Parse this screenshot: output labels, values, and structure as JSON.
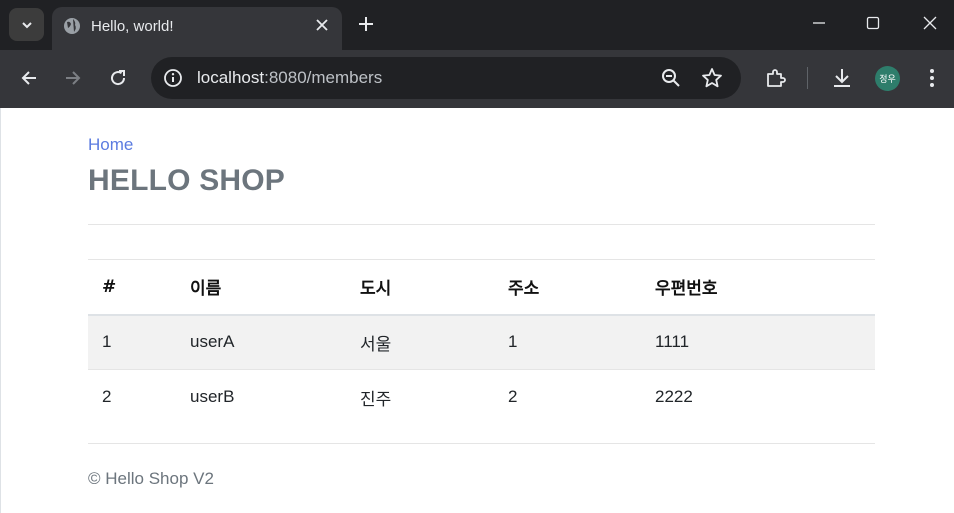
{
  "browser": {
    "tab_title": "Hello, world!",
    "url_host": "localhost",
    "url_path": ":8080/members",
    "profile_initials": "정우"
  },
  "page": {
    "home_link": "Home",
    "brand": "HELLO SHOP",
    "table": {
      "headers": [
        "#",
        "이름",
        "도시",
        "주소",
        "우편번호"
      ],
      "rows": [
        [
          "1",
          "userA",
          "서울",
          "1",
          "1111"
        ],
        [
          "2",
          "userB",
          "진주",
          "2",
          "2222"
        ]
      ]
    },
    "footer": "© Hello Shop V2"
  },
  "colors": {
    "link": "#5b7be0",
    "brand_text": "#6c757d",
    "chrome_dark": "#202124",
    "chrome_toolbar": "#35363a",
    "avatar": "#2e7d6b"
  }
}
